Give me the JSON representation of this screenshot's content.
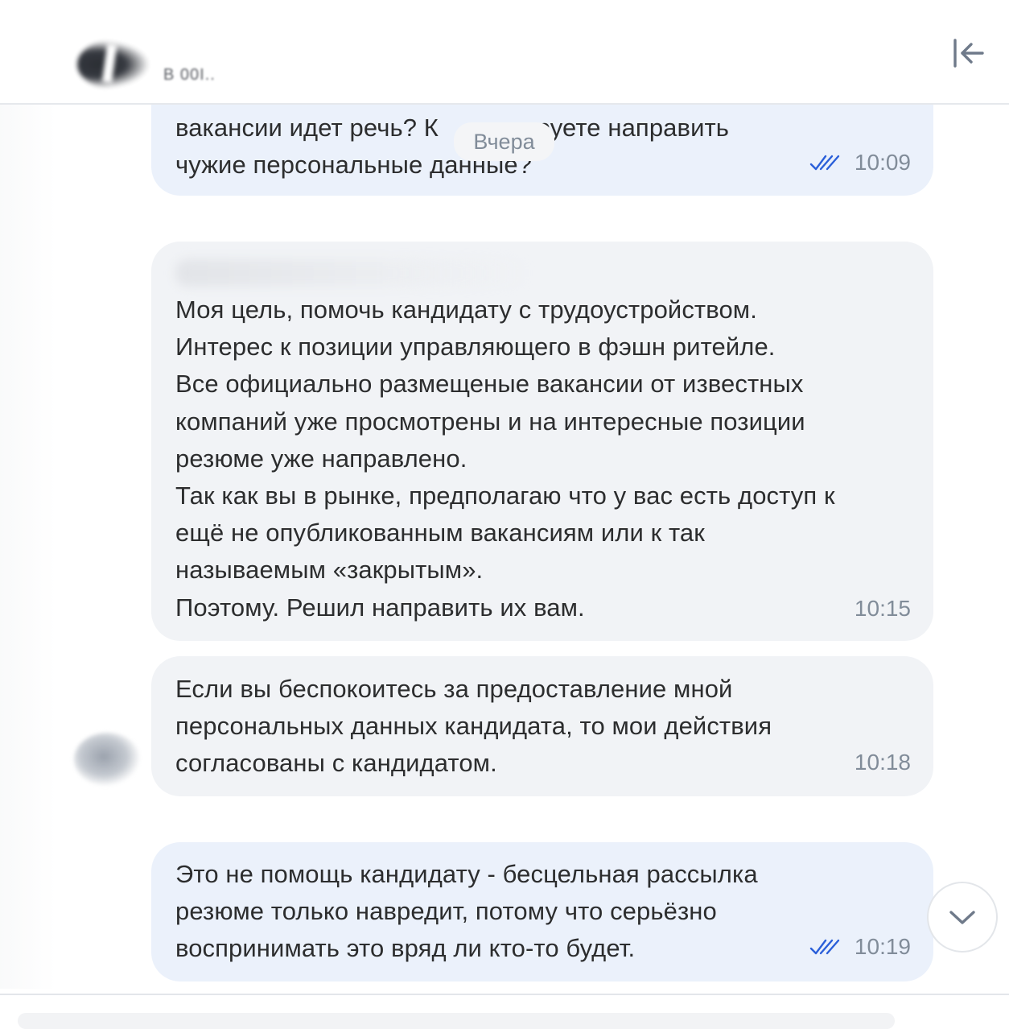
{
  "header": {
    "contact_name": "B 00I..",
    "collapse_icon": "collapse-panel-icon"
  },
  "date_chip": "Вчера",
  "messages": [
    {
      "direction": "outgoing",
      "text": "вакансии идет речь? К    планируете направить\nчужие персональные данные?",
      "time": "10:09",
      "status_icon": "double-check-icon"
    },
    {
      "direction": "incoming",
      "text": "Моя цель, помочь кандидату с трудоустройством.\nИнтерес к позиции управляющего в фэшн ритейле.\nВсе официально размещеные вакансии от известных\nкомпаний уже просмотрены и на интересные позиции\nрезюме уже направлено.\nТак как вы в рынке, предполагаю что у вас есть доступ к\nещё не опубликованным вакансиям или к так\nназываемым «закрытым».\nПоэтому. Решил направить их вам.",
      "time": "10:15"
    },
    {
      "direction": "incoming",
      "text": "Если вы беспокоитесь за предоставление мной\nперсональных данных кандидата, то мои действия\nсогласованы с кандидатом.",
      "time": "10:18"
    },
    {
      "direction": "outgoing",
      "text": "Это не помощь кандидату - бесцельная рассылка\nрезюме только навредит, потому что серьёзно\nвоспринимать это вряд ли кто-то будет.",
      "time": "10:19",
      "status_icon": "double-check-icon"
    }
  ],
  "scroll_button_icon": "chevron-down-icon",
  "colors": {
    "outgoing_bubble": "#ebf1fb",
    "incoming_bubble": "#f1f3f6",
    "read_check": "#2a5fd9",
    "timestamp": "#818c99"
  }
}
